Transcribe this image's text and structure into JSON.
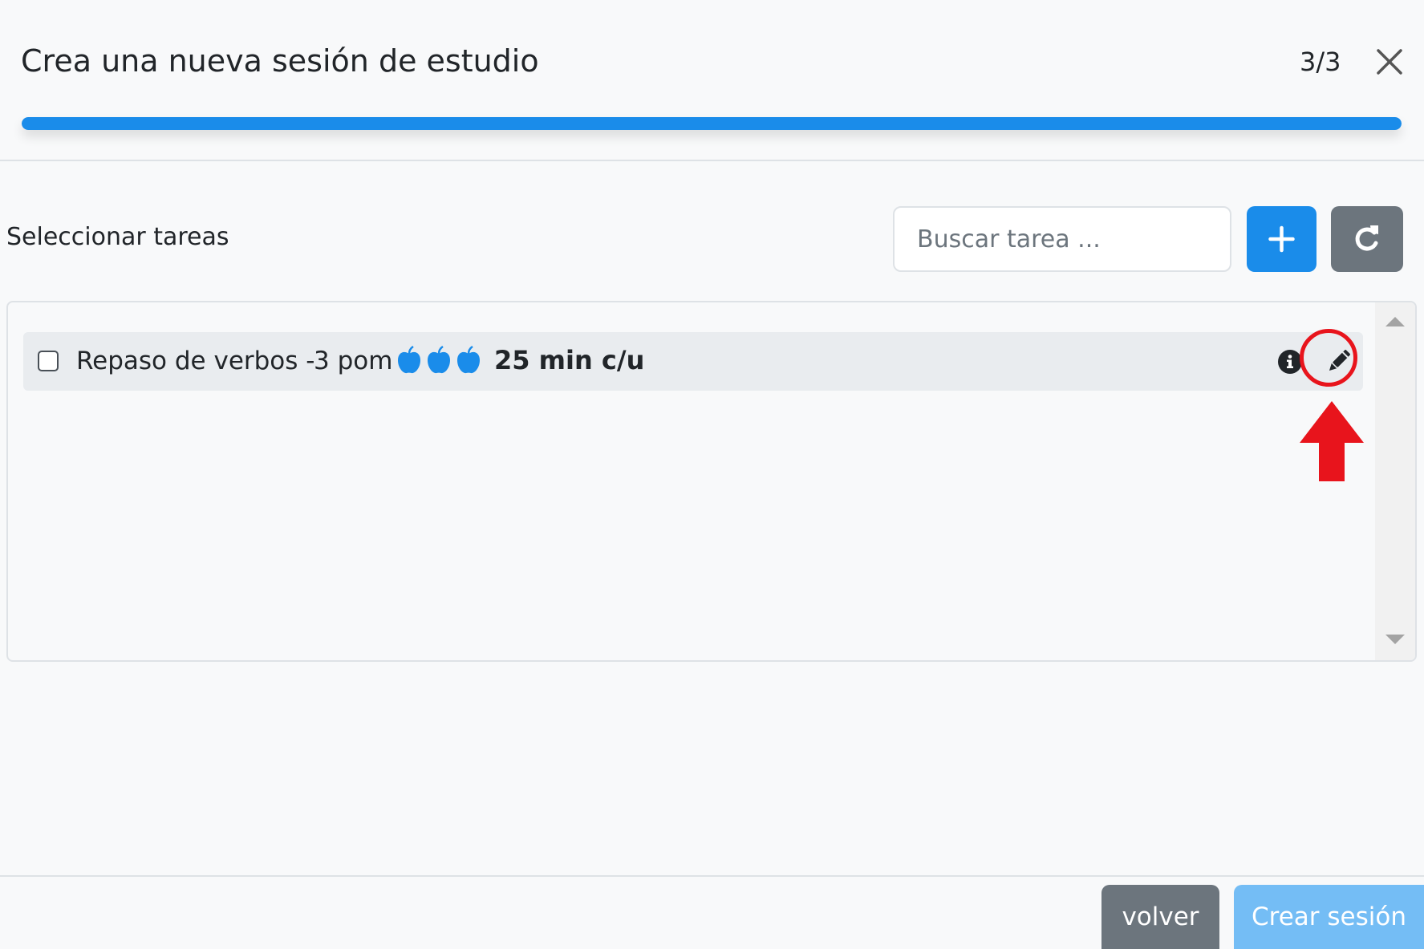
{
  "header": {
    "title": "Crea una nueva sesión de estudio",
    "step": "3/3",
    "progress_percent": 100,
    "close_icon": "close-icon"
  },
  "tasks_section": {
    "label": "Seleccionar tareas",
    "search": {
      "placeholder": "Buscar tarea ...",
      "value": ""
    },
    "add_icon": "plus-icon",
    "refresh_icon": "refresh-icon"
  },
  "task_list": [
    {
      "name": "Repaso de verbos -",
      "pomodoros": "3 pom",
      "pomodoro_icons": 3,
      "duration": "25 min c/u",
      "checked": false,
      "info_icon": "info-circle-icon",
      "edit_icon": "pencil-icon"
    }
  ],
  "annotation": {
    "color": "#e8141c"
  },
  "footer": {
    "back_label": "volver",
    "create_label": "Crear sesión"
  },
  "colors": {
    "primary": "#1a8cea",
    "secondary": "#6c757d",
    "primary_disabled": "#74bdf5",
    "apple": "#1a8cea"
  }
}
